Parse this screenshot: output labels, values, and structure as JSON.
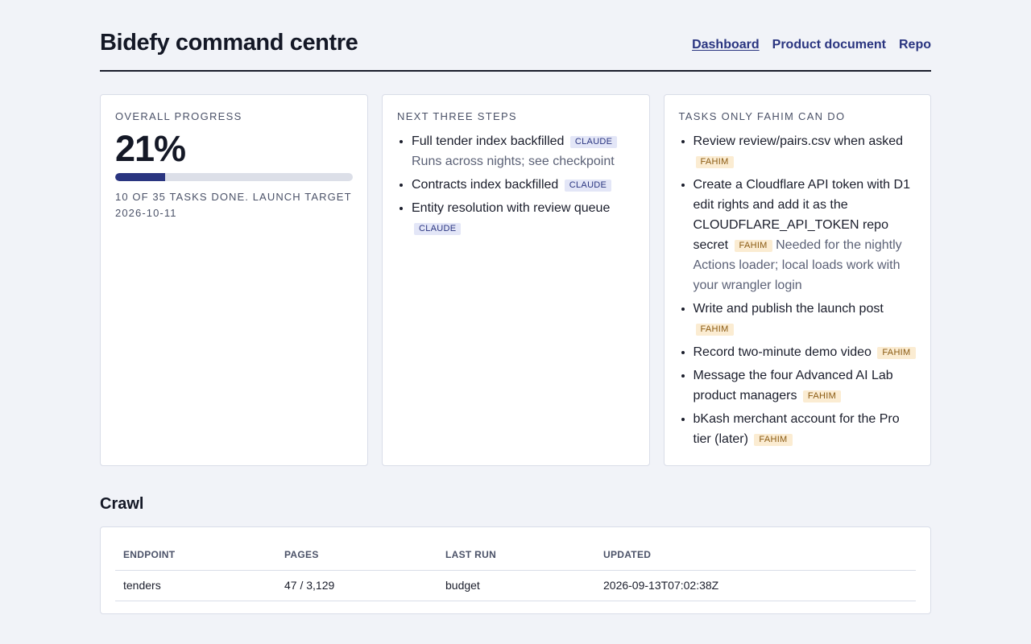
{
  "header": {
    "title": "Bidefy command centre",
    "nav": [
      {
        "label": "Dashboard",
        "active": true
      },
      {
        "label": "Product document",
        "active": false
      },
      {
        "label": "Repo",
        "active": false
      }
    ]
  },
  "progress": {
    "heading": "Overall progress",
    "percent_label": "21%",
    "fraction": 0.21,
    "note": "10 of 35 tasks done. Launch target 2026-10-11"
  },
  "next_steps": {
    "heading": "Next three steps",
    "items": [
      {
        "text": "Full tender index backfilled",
        "tag": "CLAUDE",
        "note": "Runs across nights; see checkpoint"
      },
      {
        "text": "Contracts index backfilled",
        "tag": "CLAUDE",
        "note": ""
      },
      {
        "text": "Entity resolution with review queue",
        "tag": "CLAUDE",
        "note": ""
      }
    ]
  },
  "fahim_tasks": {
    "heading": "Tasks only Fahim can do",
    "items": [
      {
        "text": "Review review/pairs.csv when asked",
        "tag": "FAHIM",
        "note": ""
      },
      {
        "text": "Create a Cloudflare API token with D1 edit rights and add it as the CLOUDFLARE_API_TOKEN repo secret",
        "tag": "FAHIM",
        "note": "Needed for the nightly Actions loader; local loads work with your wrangler login"
      },
      {
        "text": "Write and publish the launch post",
        "tag": "FAHIM",
        "note": ""
      },
      {
        "text": "Record two-minute demo video",
        "tag": "FAHIM",
        "note": ""
      },
      {
        "text": "Message the four Advanced AI Lab product managers",
        "tag": "FAHIM",
        "note": ""
      },
      {
        "text": "bKash merchant account for the Pro tier (later)",
        "tag": "FAHIM",
        "note": ""
      }
    ]
  },
  "crawl": {
    "heading": "Crawl",
    "columns": [
      "Endpoint",
      "Pages",
      "Last run",
      "Updated"
    ],
    "rows": [
      [
        "tenders",
        "47 / 3,129",
        "budget",
        "2026-09-13T07:02:38Z"
      ]
    ]
  },
  "colors": {
    "accent": "#2a3580",
    "claude_tag_bg": "#e3e6f7",
    "fahim_tag_bg": "#fbecd2"
  }
}
